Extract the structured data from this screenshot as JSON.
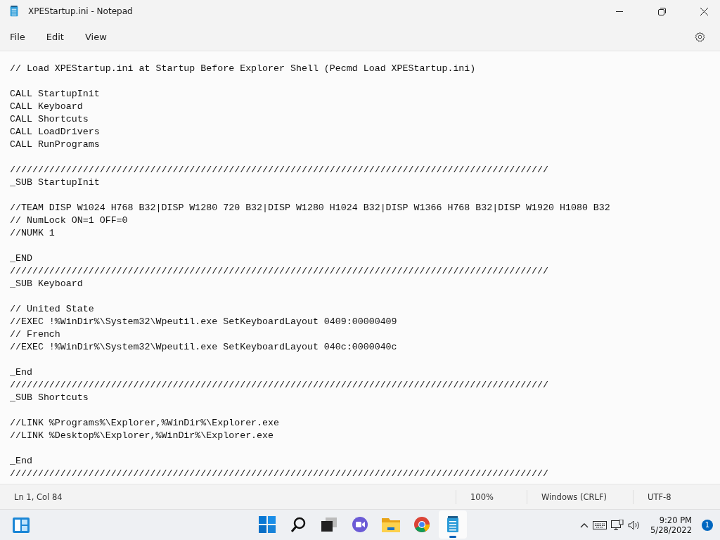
{
  "window": {
    "title": "XPEStartup.ini - Notepad"
  },
  "menu": [
    {
      "label": "File"
    },
    {
      "label": "Edit"
    },
    {
      "label": "View"
    }
  ],
  "editor": {
    "blocks": [
      [
        "// Load XPEStartup.ini at Startup Before Explorer Shell (Pecmd Load XPEStartup.ini)"
      ],
      [
        "CALL StartupInit",
        "CALL Keyboard",
        "CALL Shortcuts",
        "CALL LoadDrivers",
        "CALL RunPrograms"
      ],
      [
        "////////////////////////////////////////////////////////////////////////////////////////////////",
        "_SUB StartupInit"
      ],
      [
        "//TEAM DISP W1024 H768 B32|DISP W1280 720 B32|DISP W1280 H1024 B32|DISP W1366 H768 B32|DISP W1920 H1080 B32",
        "// NumLock ON=1 OFF=0",
        "//NUMK 1"
      ],
      [
        "_END",
        "////////////////////////////////////////////////////////////////////////////////////////////////",
        "_SUB Keyboard"
      ],
      [
        "// United State",
        "//EXEC !%WinDir%\\System32\\Wpeutil.exe SetKeyboardLayout 0409:00000409",
        "// French",
        "//EXEC !%WinDir%\\System32\\Wpeutil.exe SetKeyboardLayout 040c:0000040c"
      ],
      [
        "_End",
        "////////////////////////////////////////////////////////////////////////////////////////////////",
        "_SUB Shortcuts"
      ],
      [
        "//LINK %Programs%\\Explorer,%WinDir%\\Explorer.exe",
        "//LINK %Desktop%\\Explorer,%WinDir%\\Explorer.exe"
      ],
      [
        "_End",
        "////////////////////////////////////////////////////////////////////////////////////////////////"
      ]
    ]
  },
  "status_bar": {
    "position": "Ln 1, Col 84",
    "zoom": "100%",
    "line_endings": "Windows (CRLF)",
    "encoding": "UTF-8"
  },
  "taskbar": {
    "apps": [
      {
        "kind": "start",
        "selected": false
      },
      {
        "kind": "search",
        "selected": false
      },
      {
        "kind": "taskview",
        "selected": false
      },
      {
        "kind": "chat",
        "selected": false
      },
      {
        "kind": "folder",
        "selected": false
      },
      {
        "kind": "browser",
        "selected": false
      },
      {
        "kind": "notepad",
        "selected": true
      }
    ],
    "time": "9:20 PM",
    "date": "5/28/2022",
    "notifications": "1"
  }
}
